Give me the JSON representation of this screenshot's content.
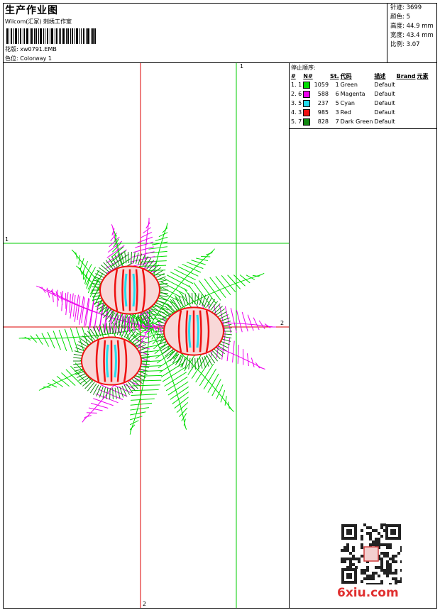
{
  "header": {
    "title": "生产作业图",
    "subtitle": "Wilcom(汇冢) 刺绣工作室",
    "design_label": "花版:",
    "design_value": "xw0791.EMB",
    "colorway_label": "色位:",
    "colorway_value": "Colorway 1"
  },
  "stats": [
    {
      "label": "针迹:",
      "value": "3699"
    },
    {
      "label": "颜色:",
      "value": "5"
    },
    {
      "label": "高度:",
      "value": "44.9 mm"
    },
    {
      "label": "宽度:",
      "value": "43.4 mm"
    },
    {
      "label": "比例:",
      "value": "3.07"
    }
  ],
  "stop_sequence": {
    "title": "停止顺序:",
    "columns": [
      "#",
      "N#",
      "St.",
      "代码",
      "描述",
      "Brand",
      "元素"
    ],
    "rows": [
      {
        "idx": "1.",
        "n": "1",
        "color": "#00dd00",
        "stitches": "1059",
        "code": "1",
        "desc": "Green",
        "brand": "Default"
      },
      {
        "idx": "2.",
        "n": "6",
        "color": "#ee00ee",
        "stitches": "588",
        "code": "6",
        "desc": "Magenta",
        "brand": "Default"
      },
      {
        "idx": "3.",
        "n": "5",
        "color": "#22ddee",
        "stitches": "237",
        "code": "5",
        "desc": "Cyan",
        "brand": "Default"
      },
      {
        "idx": "4.",
        "n": "3",
        "color": "#ee1111",
        "stitches": "985",
        "code": "3",
        "desc": "Red",
        "brand": "Default"
      },
      {
        "idx": "5.",
        "n": "7",
        "color": "#118811",
        "stitches": "828",
        "code": "7",
        "desc": "Dark Green",
        "brand": "Default"
      }
    ]
  },
  "guides": {
    "v_green": "1",
    "h_green": "1",
    "v_red": "2",
    "h_red": "2"
  },
  "watermark": "6xiu.com",
  "colors": {
    "green": "#00dd00",
    "magenta": "#ee00ee",
    "cyan": "#22ddee",
    "red": "#ee1111",
    "dark_green": "#118811"
  }
}
